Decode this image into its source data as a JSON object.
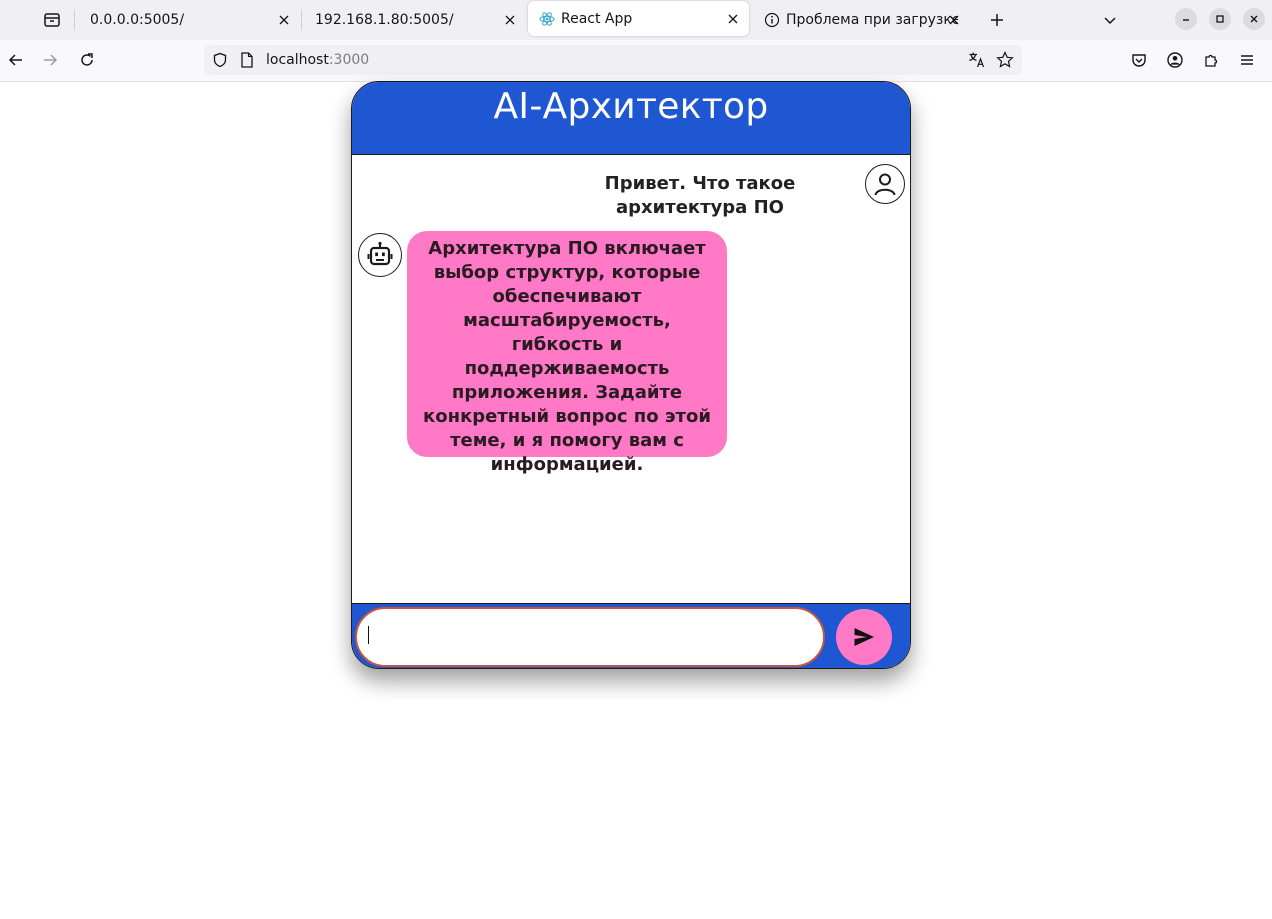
{
  "browser": {
    "tabs": [
      {
        "label": "0.0.0.0:5005/",
        "active": false
      },
      {
        "label": "192.168.1.80:5005/",
        "active": false
      },
      {
        "label": "React App",
        "active": true
      },
      {
        "label": "Проблема при загрузке",
        "active": false
      }
    ],
    "url": {
      "host": "localhost",
      "port": ":3000"
    }
  },
  "app": {
    "title": "AI-Архитектор",
    "messages": [
      {
        "role": "user",
        "text": "Привет. Что такое архитектура ПО",
        "avatar_icon": "user-icon"
      },
      {
        "role": "bot",
        "text": "Архитектура ПО включает выбор структур, которые обеспечивают масштабируемость, гибкость и поддерживаемость приложения. Задайте конкретный вопрос по этой теме, и я помогу вам с информацией.",
        "avatar_icon": "robot-icon"
      }
    ],
    "input": {
      "value": "",
      "placeholder": ""
    },
    "send_icon": "send-icon",
    "colors": {
      "primary": "#1f57d2",
      "accent": "#ff79c6",
      "input_border": "#c8553d"
    }
  }
}
